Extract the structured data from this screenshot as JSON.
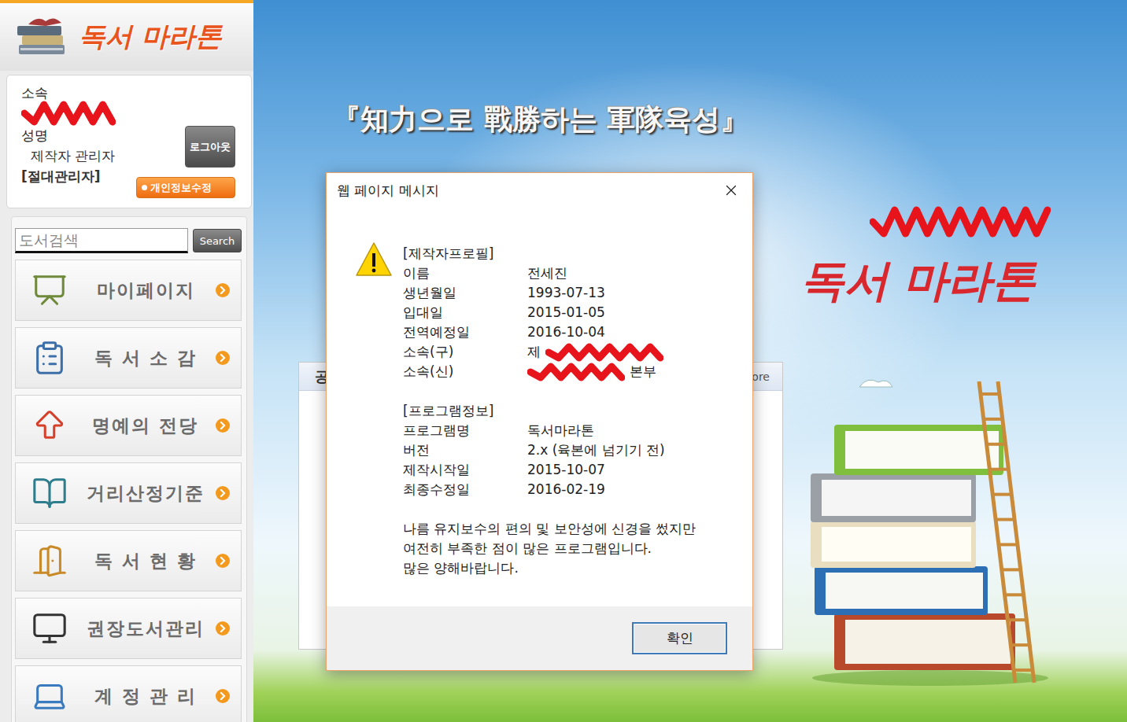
{
  "sidebar": {
    "logo": "독서 마라톤",
    "profile": {
      "affiliation_label": "소속",
      "affiliation_redacted": true,
      "name_label": "성명",
      "name": "제작자 관리자",
      "role": "[절대관리자]",
      "logout": "로그아웃",
      "edit": "개인정보수정"
    },
    "search": {
      "placeholder": "도서검색",
      "button": "Search"
    },
    "items": [
      {
        "label": "마이페이지",
        "selected": false
      },
      {
        "label": "독 서 소 감",
        "selected": false
      },
      {
        "label": "명예의 전당",
        "selected": false
      },
      {
        "label": "거리산정기준",
        "selected": false
      },
      {
        "label": "독 서 현 황",
        "selected": false
      },
      {
        "label": "권장도서관리",
        "selected": false
      },
      {
        "label": "계 정 관 리",
        "selected": false
      }
    ]
  },
  "main": {
    "slogan": "『知力으로 戰勝하는 軍隊육성』",
    "logo": {
      "text": "독서 마라톤",
      "redacted": true
    },
    "notice_panel": {
      "title": "공",
      "more": "ore"
    }
  },
  "dialog": {
    "title": "웹 페이지 메시지",
    "sections": [
      {
        "heading": "[제작자프로필]",
        "rows": [
          {
            "label": "이름",
            "value": "전세진",
            "kind": "plain"
          },
          {
            "label": "생년월일",
            "value": "1993-07-13",
            "kind": "plain"
          },
          {
            "label": "입대일",
            "value": "2015-01-05",
            "kind": "plain"
          },
          {
            "label": "전역예정일",
            "value": "2016-10-04",
            "kind": "plain"
          },
          {
            "label": "소속(구)",
            "value": "제",
            "kind": "redact-after"
          },
          {
            "label": "소속(신)",
            "value": "본부",
            "kind": "redact-before"
          }
        ]
      },
      {
        "heading": "[프로그램정보]",
        "rows": [
          {
            "label": "프로그램명",
            "value": "독서마라톤",
            "kind": "plain"
          },
          {
            "label": "버전",
            "value": "2.x (육본에 넘기기 전)",
            "kind": "plain"
          },
          {
            "label": "제작시작일",
            "value": "2015-10-07",
            "kind": "plain"
          },
          {
            "label": "최종수정일",
            "value": "2016-02-19",
            "kind": "plain"
          }
        ]
      }
    ],
    "message": [
      "나름 유지보수의 편의 및 보안성에 신경을 썼지만",
      "여전히 부족한 점이 많은 프로그램입니다.",
      "많은 양해바랍니다."
    ],
    "buttons": [
      "확인"
    ]
  }
}
